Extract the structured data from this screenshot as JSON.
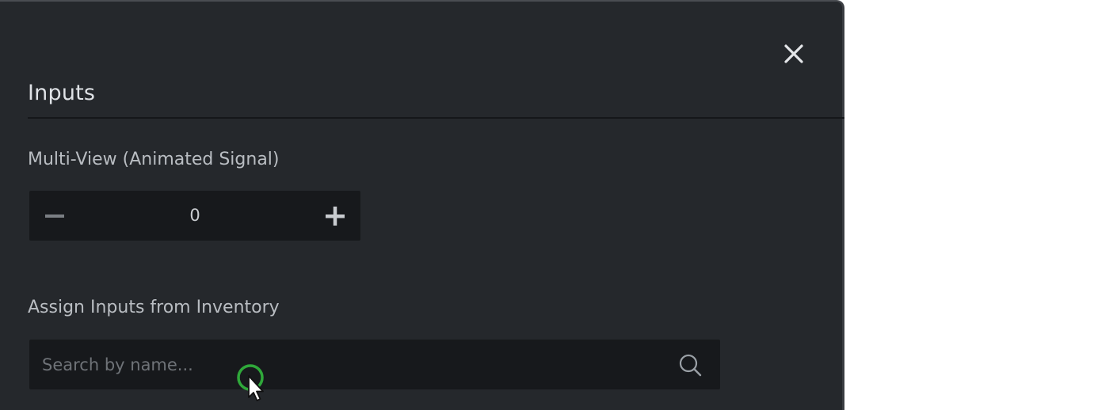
{
  "modal": {
    "section_title": "Inputs",
    "close_icon": "close-icon",
    "multiview": {
      "label": "Multi-View (Animated Signal)",
      "value": "0",
      "decrement_icon": "minus-icon",
      "increment_icon": "plus-icon"
    },
    "inventory": {
      "label": "Assign Inputs from Inventory",
      "placeholder": "Search by name...",
      "search_icon": "search-icon"
    }
  },
  "colors": {
    "panel_bg": "#25282c",
    "field_bg": "#17191c",
    "title_text": "#dfe2e6",
    "label_text": "#b9bdc2",
    "placeholder_text": "#6f7378",
    "cursor_ring": "#2fa83a"
  }
}
